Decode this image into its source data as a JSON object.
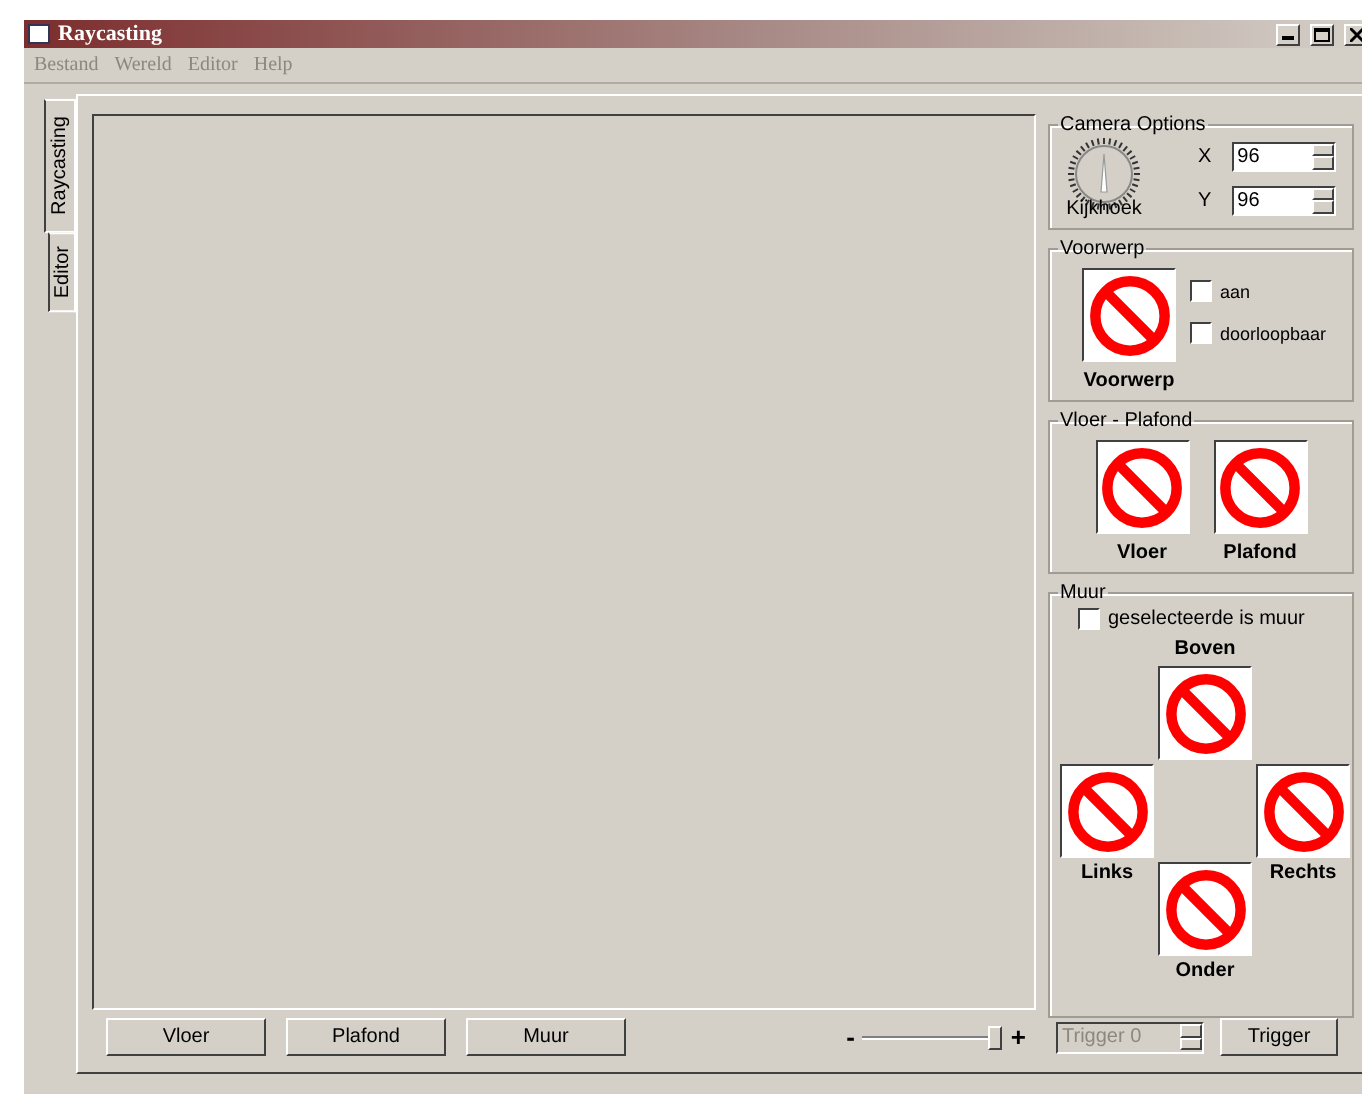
{
  "window": {
    "title": "Raycasting"
  },
  "menu": [
    {
      "label": "Bestand",
      "disabled": true
    },
    {
      "label": "Wereld",
      "disabled": true
    },
    {
      "label": "Editor",
      "disabled": true
    },
    {
      "label": "Help",
      "disabled": true
    }
  ],
  "tabs": [
    {
      "label": "Raycasting",
      "selected": true
    },
    {
      "label": "Editor",
      "selected": false
    }
  ],
  "camera_options": {
    "title": "Camera Options",
    "dial": {
      "label": "Kijkhoek"
    },
    "fields": [
      {
        "label": "X",
        "value": "96"
      },
      {
        "label": "Y",
        "value": "96"
      }
    ]
  },
  "voorwerp": {
    "title": "Voorwerp",
    "tile_label": "Voorwerp",
    "checkboxes": [
      {
        "label": "aan",
        "checked": false
      },
      {
        "label": "doorloopbaar",
        "checked": false
      }
    ]
  },
  "vloer_plafond": {
    "title": "Vloer - Plafond",
    "tiles": [
      {
        "label": "Vloer"
      },
      {
        "label": "Plafond"
      }
    ]
  },
  "muur": {
    "title": "Muur",
    "checkbox": {
      "label": "geselecteerde is muur",
      "checked": false
    },
    "top": "Boven",
    "left": "Links",
    "right": "Rechts",
    "bottom": "Onder"
  },
  "bottom_bar": {
    "buttons": [
      "Vloer",
      "Plafond",
      "Muur"
    ],
    "zoom_slider": {
      "minus": "-",
      "plus": "+",
      "level": 0.95
    },
    "trigger_field": {
      "value": "Trigger 0",
      "disabled": true
    },
    "trigger_button": "Trigger"
  }
}
